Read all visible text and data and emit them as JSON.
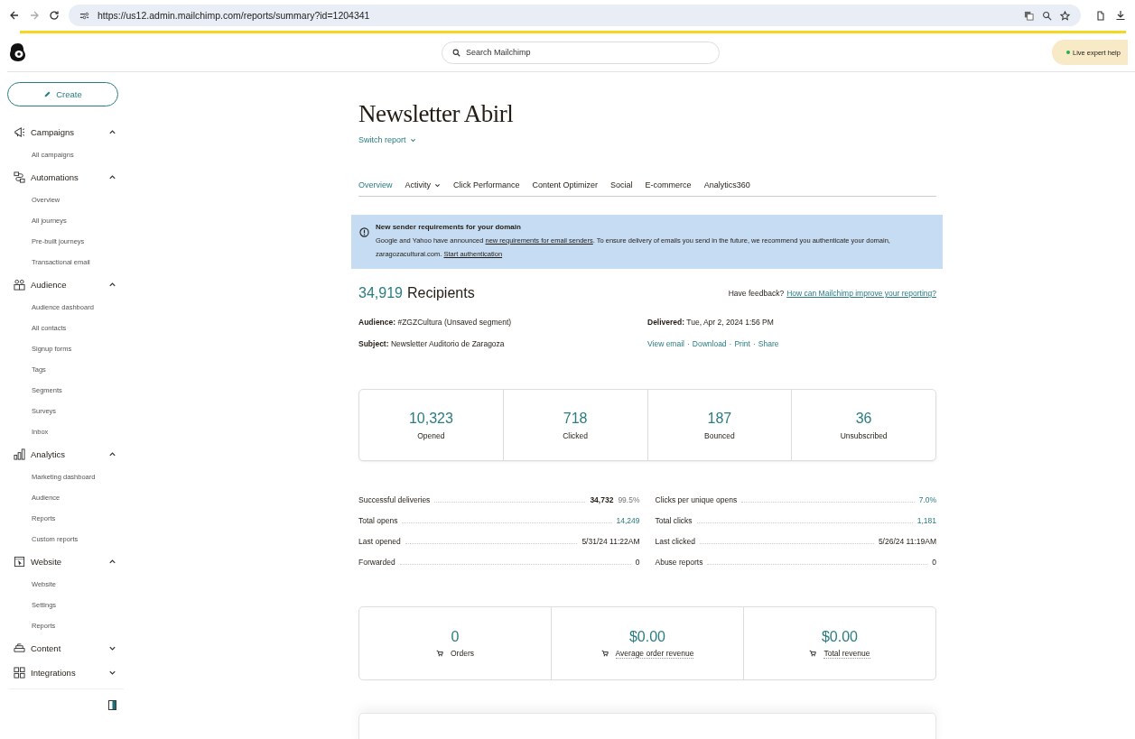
{
  "browser": {
    "url": "https://us12.admin.mailchimp.com/reports/summary?id=1204341"
  },
  "header": {
    "search_placeholder": "Search Mailchimp",
    "help_button": "Live expert help"
  },
  "sidebar": {
    "create": "Create",
    "sections": [
      {
        "kind": "campaigns",
        "label": "Campaigns",
        "expanded": true,
        "children": [
          {
            "label": "All campaigns"
          }
        ]
      },
      {
        "kind": "automations",
        "label": "Automations",
        "expanded": true,
        "children": [
          {
            "label": "Overview"
          },
          {
            "label": "All journeys"
          },
          {
            "label": "Pre-built journeys"
          },
          {
            "label": "Transactional email"
          }
        ]
      },
      {
        "kind": "audience",
        "label": "Audience",
        "expanded": true,
        "children": [
          {
            "label": "Audience dashboard"
          },
          {
            "label": "All contacts"
          },
          {
            "label": "Signup forms"
          },
          {
            "label": "Tags"
          },
          {
            "label": "Segments"
          },
          {
            "label": "Surveys"
          },
          {
            "label": "Inbox"
          }
        ]
      },
      {
        "kind": "analytics",
        "label": "Analytics",
        "expanded": true,
        "children": [
          {
            "label": "Marketing dashboard"
          },
          {
            "label": "Audience"
          },
          {
            "label": "Reports"
          },
          {
            "label": "Custom reports"
          }
        ]
      },
      {
        "kind": "website",
        "label": "Website",
        "expanded": true,
        "children": [
          {
            "label": "Website"
          },
          {
            "label": "Settings"
          },
          {
            "label": "Reports"
          }
        ]
      },
      {
        "kind": "content",
        "label": "Content",
        "expanded": false
      },
      {
        "kind": "integrations",
        "label": "Integrations",
        "expanded": false
      }
    ]
  },
  "report": {
    "title": "Newsletter Abirl",
    "switch_report": "Switch report",
    "tabs": [
      {
        "label": "Overview",
        "selected": true,
        "has_menu": false
      },
      {
        "label": "Activity",
        "selected": false,
        "has_menu": true
      },
      {
        "label": "Click Performance",
        "selected": false,
        "has_menu": false
      },
      {
        "label": "Content Optimizer",
        "selected": false,
        "has_menu": false
      },
      {
        "label": "Social",
        "selected": false,
        "has_menu": false
      },
      {
        "label": "E-commerce",
        "selected": false,
        "has_menu": false
      },
      {
        "label": "Analytics360",
        "selected": false,
        "has_menu": false
      }
    ],
    "banner": {
      "title": "New sender requirements for your domain",
      "text_before": "Google and Yahoo have announced ",
      "link": "new requirements for email senders",
      "text_after": ". To ensure delivery of emails you send in the future, we recommend you authenticate your domain, zaragozacultural.com. ",
      "action_link": "Start authentication"
    },
    "recipients": {
      "count": "34,919",
      "label": "Recipients"
    },
    "feedback": {
      "text": "Have feedback?",
      "link": "How can Mailchimp improve your reporting?"
    },
    "details": {
      "audience_label": "Audience:",
      "audience": "#ZGZCultura (Unsaved segment)",
      "subject_label": "Subject:",
      "subject": "Newsletter Auditorio de Zaragoza",
      "delivered_label": "Delivered:",
      "delivered": "Tue, Apr 2, 2024 1:56 PM",
      "actions": [
        "View email",
        "Download",
        "Print",
        "Share"
      ],
      "separator": "·"
    },
    "stats": [
      {
        "value": "10,323",
        "label": "Opened"
      },
      {
        "value": "718",
        "label": "Clicked"
      },
      {
        "value": "187",
        "label": "Bounced"
      },
      {
        "value": "36",
        "label": "Unsubscribed"
      }
    ],
    "metrics_left": [
      {
        "label": "Successful deliveries",
        "value": "34,732",
        "extra": "99.5%",
        "kind": "bold"
      },
      {
        "label": "Total opens",
        "value": "14,249",
        "kind": "link"
      },
      {
        "label": "Last opened",
        "value": "5/31/24 11:22AM",
        "kind": "plain"
      },
      {
        "label": "Forwarded",
        "value": "0",
        "kind": "plain"
      }
    ],
    "metrics_right": [
      {
        "label": "Clicks per unique opens",
        "value": "7.0%",
        "kind": "link"
      },
      {
        "label": "Total clicks",
        "value": "1,181",
        "kind": "link"
      },
      {
        "label": "Last clicked",
        "value": "5/26/24 11:19AM",
        "kind": "plain"
      },
      {
        "label": "Abuse reports",
        "value": "0",
        "kind": "plain"
      }
    ],
    "ecommerce": [
      {
        "value": "0",
        "label": "Orders",
        "underlined": false
      },
      {
        "value": "$0.00",
        "label": "Average order revenue",
        "underlined": true
      },
      {
        "value": "$0.00",
        "label": "Total revenue",
        "underlined": true
      }
    ]
  }
}
